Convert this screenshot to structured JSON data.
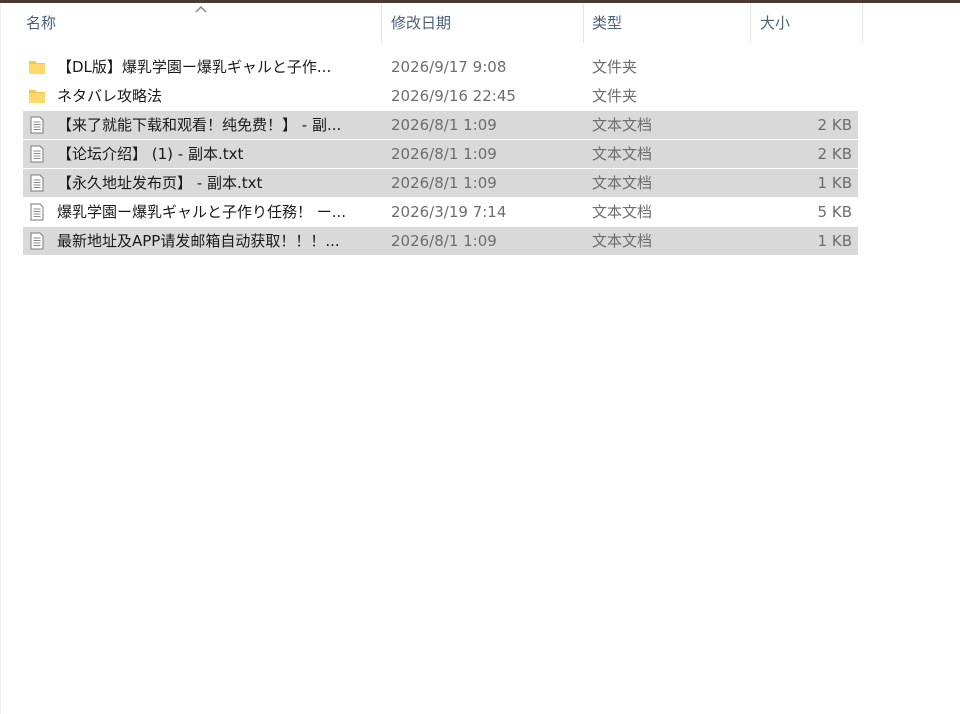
{
  "colors": {
    "header_text": "#4c607a",
    "selection": "#d9d9d9",
    "folder": "#f5c84c",
    "text": "#1a1a1a",
    "meta_text": "#6d6d6d"
  },
  "header": {
    "name": "名称",
    "date": "修改日期",
    "type": "类型",
    "size": "大小",
    "sort_icon": "sort-ascending-chevron-icon"
  },
  "files": [
    {
      "icon": "folder-icon",
      "name": "【DL版】爆乳学園ー爆乳ギャルと子作...",
      "date": "2026/9/17 9:08",
      "type": "文件夹",
      "size": "",
      "selected": false
    },
    {
      "icon": "folder-icon",
      "name": "ネタバレ攻略法",
      "date": "2026/9/16 22:45",
      "type": "文件夹",
      "size": "",
      "selected": false
    },
    {
      "icon": "text-document-icon",
      "name": "【来了就能下载和观看！纯免费！】 - 副...",
      "date": "2026/8/1 1:09",
      "type": "文本文档",
      "size": "2 KB",
      "selected": true
    },
    {
      "icon": "text-document-icon",
      "name": "【论坛介绍】 (1) - 副本.txt",
      "date": "2026/8/1 1:09",
      "type": "文本文档",
      "size": "2 KB",
      "selected": true
    },
    {
      "icon": "text-document-icon",
      "name": "【永久地址发布页】 - 副本.txt",
      "date": "2026/8/1 1:09",
      "type": "文本文档",
      "size": "1 KB",
      "selected": true
    },
    {
      "icon": "text-document-icon",
      "name": "爆乳学園ー爆乳ギャルと子作り任務！ ー...",
      "date": "2026/3/19 7:14",
      "type": "文本文档",
      "size": "5 KB",
      "selected": false
    },
    {
      "icon": "text-document-icon",
      "name": "最新地址及APP请发邮箱自动获取！！！...",
      "date": "2026/8/1 1:09",
      "type": "文本文档",
      "size": "1 KB",
      "selected": true
    }
  ]
}
